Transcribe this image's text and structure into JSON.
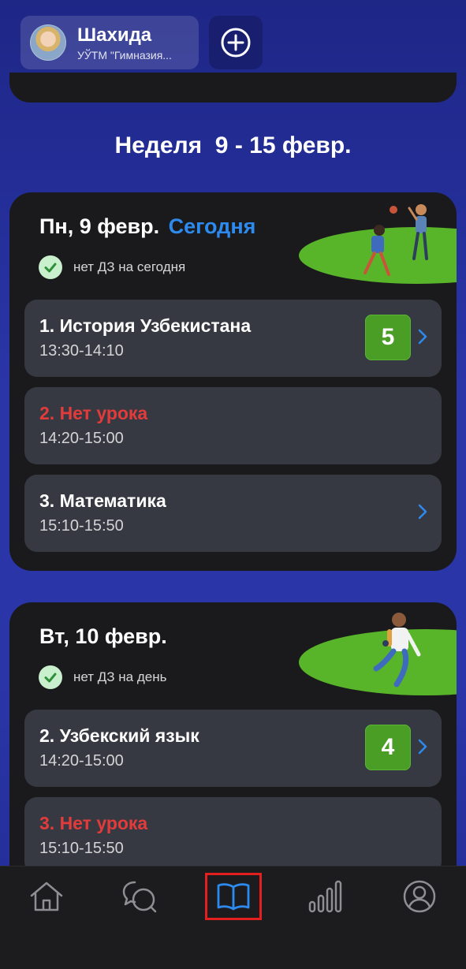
{
  "profile": {
    "name": "Шахида",
    "school": "УЎТМ \"Гимназия..."
  },
  "week": {
    "title": "Неделя  9 - 15 февр."
  },
  "days": [
    {
      "date": "Пн, 9 февр.",
      "today_label": "Сегодня",
      "homework_status": "нет ДЗ на сегодня",
      "lessons": [
        {
          "name": "1. История Узбекистана",
          "time": "13:30-14:10",
          "grade": "5",
          "absent": false
        },
        {
          "name": "2. Нет урока",
          "time": "14:20-15:00",
          "grade": null,
          "absent": true
        },
        {
          "name": "3. Математика",
          "time": "15:10-15:50",
          "grade": null,
          "absent": false
        }
      ]
    },
    {
      "date": "Вт, 10 февр.",
      "homework_status": "нет ДЗ на день",
      "lessons": [
        {
          "name": "2. Узбекский язык",
          "time": "14:20-15:00",
          "grade": "4",
          "absent": false
        },
        {
          "name": "3. Нет урока",
          "time": "15:10-15:50",
          "grade": null,
          "absent": true
        }
      ]
    }
  ],
  "bottom_nav": {
    "items": [
      {
        "id": "home",
        "icon": "home-icon"
      },
      {
        "id": "chats",
        "icon": "chat-bubbles-icon"
      },
      {
        "id": "diary",
        "icon": "book-icon",
        "active": true
      },
      {
        "id": "grades",
        "icon": "bar-chart-icon"
      },
      {
        "id": "profile",
        "icon": "user-circle-icon"
      }
    ]
  },
  "colors": {
    "background": "#2a35a8",
    "card": "#1a1a1c",
    "lesson": "#363941",
    "accent": "#2d8bf0",
    "absent": "#e33b3b",
    "grade": "#4a9e26",
    "highlight": "#e41f1f"
  }
}
